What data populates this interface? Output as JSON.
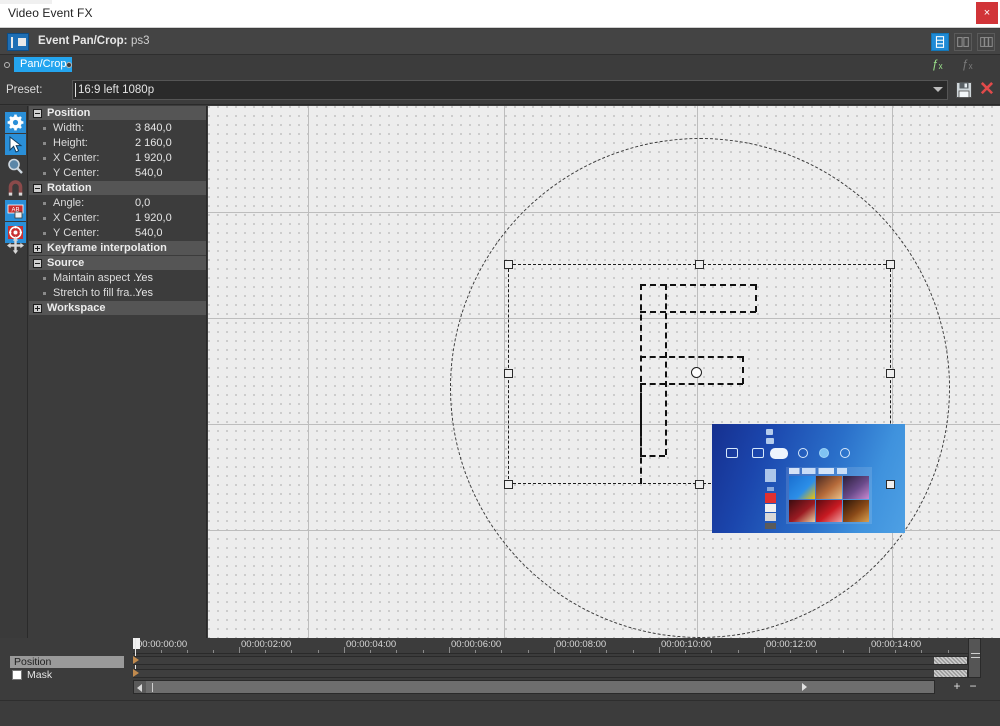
{
  "window": {
    "title": "Video Event FX",
    "close_label": "×"
  },
  "header": {
    "plugin_label": "Event Pan/Crop:",
    "plugin_value": "ps3",
    "icon": "pan-crop-icon",
    "layout_buttons": [
      {
        "name": "layout-single-icon",
        "active": true
      },
      {
        "name": "layout-columns-icon",
        "active": false
      },
      {
        "name": "layout-grid-icon",
        "active": false
      }
    ]
  },
  "chain": {
    "chip_label": "Pan/Crop",
    "fx_add_label": "ƒₓ",
    "fx_remove_label": "ƒₓ"
  },
  "preset": {
    "label": "Preset:",
    "value": "16:9 left 1080p",
    "placeholder": "",
    "save_icon": "save-floppy-icon",
    "delete_icon": "delete-preset-icon",
    "delete_label": "✕"
  },
  "toolbar": {
    "tools": [
      {
        "name": "tool-settings",
        "icon": "gear-icon",
        "selected": true
      },
      {
        "name": "tool-selection",
        "icon": "arrow-pointer-icon",
        "selected": true
      },
      {
        "name": "tool-zoom",
        "icon": "magnifier-icon",
        "selected": false
      },
      {
        "name": "tool-magnet-snap",
        "icon": "magnet-icon",
        "selected": false
      },
      {
        "name": "tool-mask-toggle",
        "icon": "mask-icon",
        "selected": true
      },
      {
        "name": "tool-rotate",
        "icon": "rotate-circle-icon",
        "selected": true
      },
      {
        "name": "tool-move",
        "icon": "move-cross-icon",
        "selected": false
      }
    ]
  },
  "properties": {
    "groups": [
      {
        "name": "position",
        "title": "Position",
        "expanded": true,
        "rows": [
          {
            "label": "Width:",
            "value": "3 840,0"
          },
          {
            "label": "Height:",
            "value": "2 160,0"
          },
          {
            "label": "X Center:",
            "value": "1 920,0"
          },
          {
            "label": "Y Center:",
            "value": "540,0"
          }
        ]
      },
      {
        "name": "rotation",
        "title": "Rotation",
        "expanded": true,
        "rows": [
          {
            "label": "Angle:",
            "value": "0,0"
          },
          {
            "label": "X Center:",
            "value": "1 920,0"
          },
          {
            "label": "Y Center:",
            "value": "540,0"
          }
        ]
      },
      {
        "name": "keyframe-interpolation",
        "title": "Keyframe interpolation",
        "expanded": false,
        "rows": []
      },
      {
        "name": "source",
        "title": "Source",
        "expanded": true,
        "rows": [
          {
            "label": "Maintain aspect ...",
            "value": "Yes"
          },
          {
            "label": "Stretch to fill fra...",
            "value": "Yes"
          }
        ]
      },
      {
        "name": "workspace",
        "title": "Workspace",
        "expanded": false,
        "rows": []
      }
    ]
  },
  "canvas": {
    "preview_description": "PlayStation home screen video frame",
    "ps_panel_title": "ps-library-panel",
    "tiles": [
      {
        "name": "tile-1",
        "colors": [
          "#1a6fd0",
          "#2c8fe8",
          "#f2c400"
        ]
      },
      {
        "name": "tile-2",
        "colors": [
          "#4a2a22",
          "#b56a3a",
          "#e8c08a"
        ]
      },
      {
        "name": "tile-3",
        "colors": [
          "#2a1f3a",
          "#6a4a8a",
          "#c88ad0"
        ]
      },
      {
        "name": "tile-4",
        "colors": [
          "#3a0c10",
          "#9b1b22",
          "#e8d0a0"
        ]
      },
      {
        "name": "tile-5",
        "colors": [
          "#5a0a10",
          "#c81a22",
          "#f0a0a0"
        ]
      },
      {
        "name": "tile-6",
        "colors": [
          "#2a1408",
          "#8a4a18",
          "#d8a050"
        ]
      }
    ]
  },
  "timeline": {
    "tracks": [
      {
        "name": "track-position",
        "label": "Position",
        "selected": true,
        "has_checkbox": false
      },
      {
        "name": "track-mask",
        "label": "Mask",
        "selected": false,
        "has_checkbox": true
      }
    ],
    "ruler_ticks": [
      "00:00:00:00",
      "00:00:02:00",
      "00:00:04:00",
      "00:00:06:00",
      "00:00:08:00",
      "00:00:10:00",
      "00:00:12:00",
      "00:00:14:00"
    ],
    "keyframe_buttons": [
      {
        "name": "lock-keyframes-button",
        "icon": "lock-icon"
      },
      {
        "name": "first-keyframe-button",
        "icon": "first-arrow-icon"
      },
      {
        "name": "previous-keyframe-button",
        "icon": "prev-arrow-icon"
      },
      {
        "name": "next-keyframe-button",
        "icon": "next-arrow-icon"
      },
      {
        "name": "last-keyframe-button",
        "icon": "last-arrow-icon"
      },
      {
        "name": "add-keyframe-button",
        "icon": "add-keyframe-icon"
      },
      {
        "name": "delete-keyframe-button",
        "icon": "delete-keyframe-icon"
      }
    ],
    "zoom_in_label": "+",
    "zoom_out_label": "−",
    "current_timecode": "00:00:00:00"
  },
  "colors": {
    "accent_blue": "#24a5ef",
    "panel_bg": "#3c3c3c",
    "group_bg": "#555555",
    "canvas_bg": "#ededed",
    "close_red": "#d13438"
  }
}
